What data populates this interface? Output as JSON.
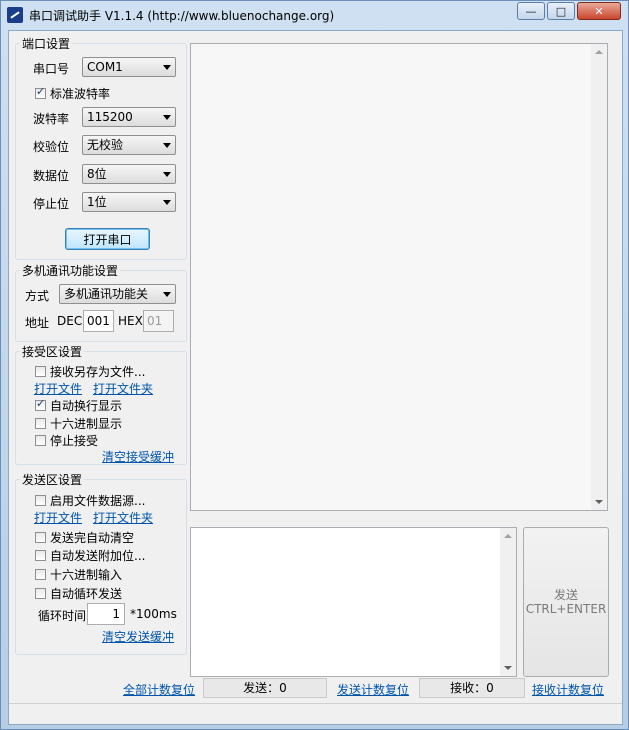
{
  "window": {
    "title": "串口调试助手 V1.1.4 (http://www.bluenochange.org)",
    "controls": {
      "minimize": "—",
      "maximize": "□",
      "close": "✕"
    }
  },
  "port_settings": {
    "legend": "端口设置",
    "port": {
      "label": "串口号",
      "value": "COM1"
    },
    "standard_baud": {
      "label": "标准波特率",
      "checked": true
    },
    "baud": {
      "label": "波特率",
      "value": "115200"
    },
    "parity": {
      "label": "校验位",
      "value": "无校验"
    },
    "databits": {
      "label": "数据位",
      "value": "8位"
    },
    "stopbits": {
      "label": "停止位",
      "value": "1位"
    },
    "open_button": "打开串口"
  },
  "multi_settings": {
    "legend": "多机通讯功能设置",
    "mode_label": "方式",
    "mode_value": "多机通讯功能关",
    "address_label": "地址",
    "dec_label": "DEC",
    "dec_value": "001",
    "hex_label": "HEX",
    "hex_value": "01"
  },
  "receive_settings": {
    "legend": "接受区设置",
    "save_to_file": "接收另存为文件...",
    "open_file": "打开文件",
    "open_folder": "打开文件夹",
    "auto_newline": "自动换行显示",
    "hex_display": "十六进制显示",
    "stop_receive": "停止接受",
    "clear_receive": "清空接受缓冲"
  },
  "send_settings": {
    "legend": "发送区设置",
    "file_source": "启用文件数据源...",
    "open_file": "打开文件",
    "open_folder": "打开文件夹",
    "auto_clear": "发送完自动清空",
    "auto_append": "自动发送附加位...",
    "hex_input": "十六进制输入",
    "loop_send": "自动循环发送",
    "loop_label": "循环时间",
    "loop_value": "1",
    "loop_unit": "*100ms",
    "clear_send": "清空发送缓冲"
  },
  "send_button": {
    "line1": "发送",
    "line2": "CTRL+ENTER"
  },
  "counters": {
    "reset_all": "全部计数复位",
    "send_count": "发送：0",
    "reset_send": "发送计数复位",
    "recv_count": "接收：0",
    "reset_recv": "接收计数复位"
  }
}
